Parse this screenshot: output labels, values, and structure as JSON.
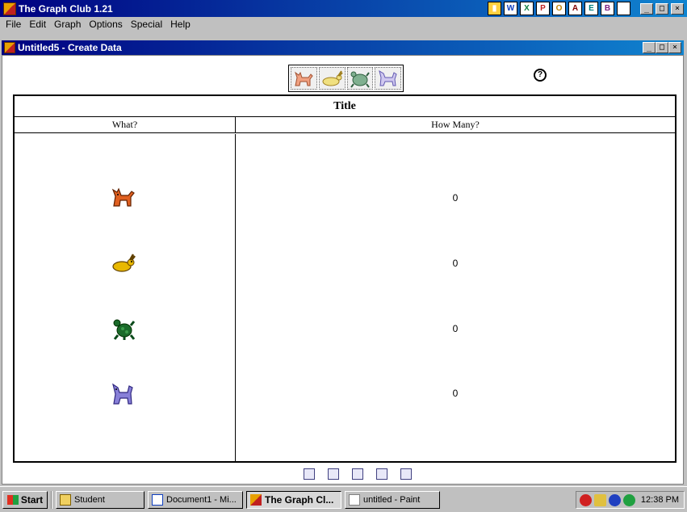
{
  "app": {
    "title": "The Graph Club 1.21"
  },
  "menu": [
    "File",
    "Edit",
    "Graph",
    "Options",
    "Special",
    "Help"
  ],
  "quick_launch": [
    "W",
    "X",
    "P",
    "O",
    "A",
    "E",
    "B",
    "?"
  ],
  "window_controls": {
    "minimize": "_",
    "maximize": "□",
    "close": "×"
  },
  "child_window": {
    "title": "Untitled5 - Create Data"
  },
  "picture_bar": {
    "icons": [
      "cat-icon",
      "rabbit-icon",
      "turtle-icon",
      "dog-icon"
    ]
  },
  "help": {
    "glyph": "?"
  },
  "table": {
    "title": "Title",
    "col_what": "What?",
    "col_how_many": "How Many?",
    "rows": [
      {
        "icon": "cat-icon",
        "value": "0"
      },
      {
        "icon": "rabbit-icon",
        "value": "0"
      },
      {
        "icon": "turtle-icon",
        "value": "0"
      },
      {
        "icon": "dog-icon",
        "value": "0"
      }
    ]
  },
  "bottom_tools": [
    "table-view-icon",
    "pictograph-view-icon",
    "bar-graph-icon",
    "line-graph-icon",
    "circle-graph-icon"
  ],
  "taskbar": {
    "start": "Start",
    "tasks": [
      {
        "label": "Student",
        "active": false
      },
      {
        "label": "Document1 - Mi...",
        "active": false
      },
      {
        "label": "The Graph Cl...",
        "active": true
      },
      {
        "label": "untitled - Paint",
        "active": false
      }
    ],
    "clock": "12:38 PM"
  },
  "colors": {
    "titlebar": "#000080",
    "cat": "#e06020",
    "rabbit": "#e8b800",
    "turtle": "#1a6a2a",
    "dog": "#8880d8"
  }
}
